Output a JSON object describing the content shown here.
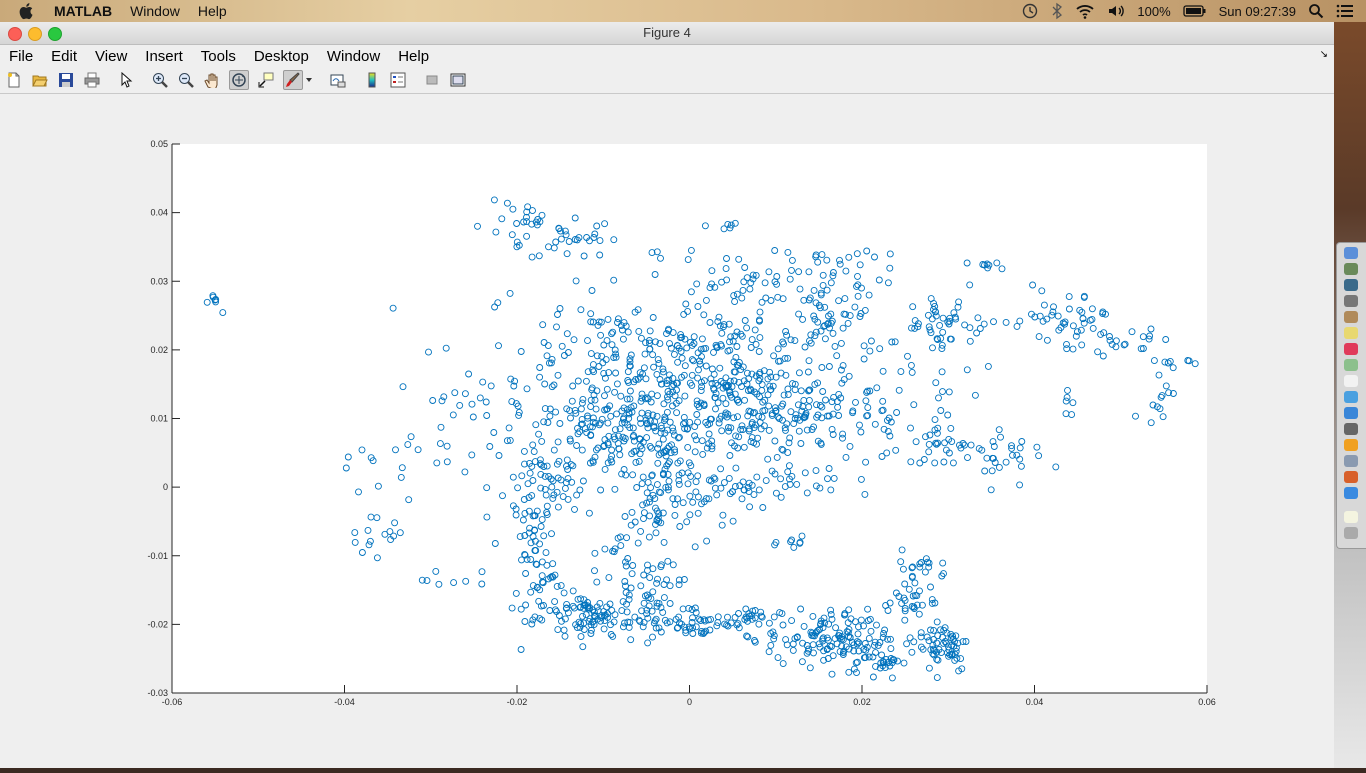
{
  "menubar": {
    "app_name": "MATLAB",
    "items": [
      "Window",
      "Help"
    ],
    "battery": "100%",
    "clock": "Sun 09:27:39"
  },
  "window": {
    "title": "Figure 4",
    "menu": [
      "File",
      "Edit",
      "View",
      "Insert",
      "Tools",
      "Desktop",
      "Window",
      "Help"
    ]
  },
  "toolbar": {
    "buttons": [
      "new-figure",
      "open-file",
      "save-figure",
      "print-figure",
      "edit-plot",
      "zoom-in",
      "zoom-out",
      "pan",
      "rotate-3d",
      "data-cursor",
      "brush",
      "brush-dropdown",
      "link-plot",
      "insert-colorbar",
      "insert-legend",
      "hide-plot-tools",
      "show-plot-tools"
    ]
  },
  "colors": {
    "marker": "#0072bd"
  },
  "chart_data": {
    "type": "scatter",
    "marker": "o",
    "xlim": [
      -0.06,
      0.06
    ],
    "ylim": [
      -0.03,
      0.05
    ],
    "xticks": [
      "-0.06",
      "-0.04",
      "-0.02",
      "0",
      "0.02",
      "0.04",
      "0.06"
    ],
    "yticks": [
      "-0.03",
      "-0.02",
      "-0.01",
      "0",
      "0.01",
      "0.02",
      "0.03",
      "0.04",
      "0.05"
    ],
    "grid": false,
    "clusters": [
      {
        "x": -0.0551,
        "y": 0.0272,
        "sx": 0.0004,
        "sy": 0.0005,
        "n": 6
      },
      {
        "x": -0.054,
        "y": 0.0254,
        "sx": 0.0001,
        "sy": 0.0001,
        "n": 1
      },
      {
        "x": -0.036,
        "y": 0.0035,
        "sx": 0.003,
        "sy": 0.003,
        "n": 14
      },
      {
        "x": -0.0355,
        "y": -0.0075,
        "sx": 0.002,
        "sy": 0.0015,
        "n": 14
      },
      {
        "x": -0.027,
        "y": -0.0135,
        "sx": 0.002,
        "sy": 0.0008,
        "n": 8
      },
      {
        "x": -0.026,
        "y": 0.009,
        "sx": 0.0035,
        "sy": 0.0045,
        "n": 30
      },
      {
        "x": -0.0185,
        "y": 0.0375,
        "sx": 0.0035,
        "sy": 0.002,
        "n": 30
      },
      {
        "x": -0.0135,
        "y": 0.0365,
        "sx": 0.0025,
        "sy": 0.002,
        "n": 20
      },
      {
        "x": 0.0035,
        "y": 0.038,
        "sx": 0.0012,
        "sy": 0.0003,
        "n": 6
      },
      {
        "x": -0.01,
        "y": 0.018,
        "sx": 0.007,
        "sy": 0.007,
        "n": 160
      },
      {
        "x": -0.0085,
        "y": 0.007,
        "sx": 0.006,
        "sy": 0.003,
        "n": 120
      },
      {
        "x": -0.002,
        "y": 0.012,
        "sx": 0.005,
        "sy": 0.006,
        "n": 190
      },
      {
        "x": 0.006,
        "y": 0.015,
        "sx": 0.005,
        "sy": 0.007,
        "n": 190
      },
      {
        "x": 0.012,
        "y": 0.011,
        "sx": 0.004,
        "sy": 0.003,
        "n": 90
      },
      {
        "x": 0.017,
        "y": 0.024,
        "sx": 0.003,
        "sy": 0.003,
        "n": 50
      },
      {
        "x": 0.019,
        "y": 0.033,
        "sx": 0.004,
        "sy": 0.001,
        "n": 15
      },
      {
        "x": 0.022,
        "y": 0.011,
        "sx": 0.0025,
        "sy": 0.0035,
        "n": 35
      },
      {
        "x": 0.014,
        "y": 0.03,
        "sx": 0.006,
        "sy": 0.0025,
        "n": 30
      },
      {
        "x": 0.005,
        "y": 0.03,
        "sx": 0.003,
        "sy": 0.002,
        "n": 25
      },
      {
        "x": -0.015,
        "y": 0.0,
        "sx": 0.003,
        "sy": 0.0025,
        "n": 40
      },
      {
        "x": -0.018,
        "y": -0.009,
        "sx": 0.0012,
        "sy": 0.005,
        "n": 60
      },
      {
        "x": -0.0165,
        "y": -0.015,
        "sx": 0.0015,
        "sy": 0.002,
        "n": 15
      },
      {
        "x": -0.003,
        "y": -0.003,
        "sx": 0.0025,
        "sy": 0.0035,
        "n": 70
      },
      {
        "x": 0.007,
        "y": 0.0,
        "sx": 0.004,
        "sy": 0.0012,
        "n": 35
      },
      {
        "x": 0.017,
        "y": 0.0,
        "sx": 0.002,
        "sy": 0.001,
        "n": 8
      },
      {
        "x": -0.009,
        "y": -0.009,
        "sx": 0.0015,
        "sy": 0.001,
        "n": 8
      },
      {
        "x": 0.0125,
        "y": -0.008,
        "sx": 0.001,
        "sy": 0.0007,
        "n": 8
      },
      {
        "x": -0.0115,
        "y": -0.019,
        "sx": 0.0025,
        "sy": 0.002,
        "n": 85
      },
      {
        "x": -0.005,
        "y": -0.016,
        "sx": 0.002,
        "sy": 0.003,
        "n": 60
      },
      {
        "x": 0.001,
        "y": -0.0195,
        "sx": 0.003,
        "sy": 0.0012,
        "n": 50
      },
      {
        "x": 0.0065,
        "y": -0.0195,
        "sx": 0.002,
        "sy": 0.001,
        "n": 25
      },
      {
        "x": 0.016,
        "y": -0.022,
        "sx": 0.0035,
        "sy": 0.002,
        "n": 120
      },
      {
        "x": 0.0215,
        "y": -0.025,
        "sx": 0.0015,
        "sy": 0.0015,
        "n": 40
      },
      {
        "x": 0.0255,
        "y": -0.0165,
        "sx": 0.0015,
        "sy": 0.0012,
        "n": 25
      },
      {
        "x": 0.0295,
        "y": -0.023,
        "sx": 0.0015,
        "sy": 0.002,
        "n": 60
      },
      {
        "x": 0.0275,
        "y": -0.0115,
        "sx": 0.0015,
        "sy": 0.0012,
        "n": 20
      },
      {
        "x": 0.029,
        "y": 0.023,
        "sx": 0.002,
        "sy": 0.0025,
        "n": 40
      },
      {
        "x": 0.03,
        "y": 0.006,
        "sx": 0.0025,
        "sy": 0.0015,
        "n": 30
      },
      {
        "x": 0.037,
        "y": 0.005,
        "sx": 0.002,
        "sy": 0.0025,
        "n": 25
      },
      {
        "x": 0.034,
        "y": 0.0245,
        "sx": 0.003,
        "sy": 0.002,
        "n": 15
      },
      {
        "x": 0.0345,
        "y": 0.0325,
        "sx": 0.001,
        "sy": 0.0004,
        "n": 8
      },
      {
        "x": 0.03,
        "y": 0.014,
        "sx": 0.002,
        "sy": 0.002,
        "n": 10
      },
      {
        "x": 0.044,
        "y": 0.024,
        "sx": 0.003,
        "sy": 0.0025,
        "n": 45
      },
      {
        "x": 0.044,
        "y": 0.0125,
        "sx": 0.001,
        "sy": 0.0012,
        "n": 6
      },
      {
        "x": 0.051,
        "y": 0.0215,
        "sx": 0.002,
        "sy": 0.001,
        "n": 15
      },
      {
        "x": 0.056,
        "y": 0.018,
        "sx": 0.001,
        "sy": 0.0006,
        "n": 8
      },
      {
        "x": 0.0545,
        "y": 0.013,
        "sx": 0.001,
        "sy": 0.002,
        "n": 12
      }
    ]
  }
}
